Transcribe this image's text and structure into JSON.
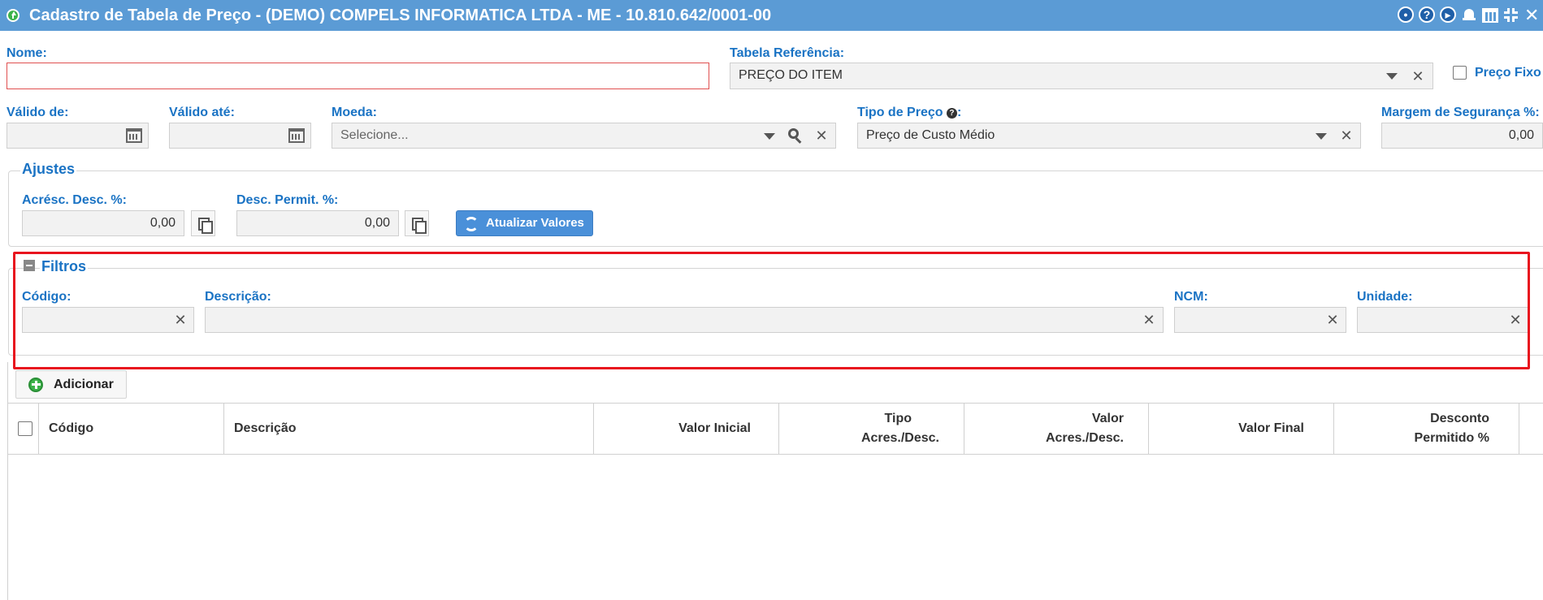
{
  "window": {
    "title": "Cadastro de Tabela de Preço - (DEMO) COMPELS INFORMATICA LTDA - ME - 10.810.642/0001-00",
    "toolbar_icons": [
      "settings-icon",
      "help-icon",
      "play-icon",
      "bell-icon",
      "calendar-icon",
      "fullscreen-icon",
      "close-icon"
    ],
    "help_glyph": "?",
    "close_glyph": "✕"
  },
  "form": {
    "nome": {
      "label": "Nome:",
      "value": ""
    },
    "tabela_referencia": {
      "label": "Tabela Referência:",
      "value": "PREÇO DO ITEM"
    },
    "preco_fixo": {
      "label": "Preço Fixo",
      "checked": false
    },
    "valido_de": {
      "label": "Válido de:",
      "value": ""
    },
    "valido_ate": {
      "label": "Válido até:",
      "value": ""
    },
    "moeda": {
      "label": "Moeda:",
      "placeholder": "Selecione..."
    },
    "tipo_preco": {
      "label": "Tipo de Preço",
      "suffix": ":",
      "value": "Preço de Custo Médio"
    },
    "margem_seguranca": {
      "label": "Margem de Segurança %:",
      "value": "0,00"
    }
  },
  "ajustes": {
    "legend": "Ajustes",
    "acresc_desc": {
      "label": "Acrésc. Desc. %:",
      "value": "0,00"
    },
    "desc_permit": {
      "label": "Desc. Permit. %:",
      "value": "0,00"
    },
    "atualizar_label": "Atualizar Valores"
  },
  "filtros": {
    "legend": "Filtros",
    "codigo": {
      "label": "Código:",
      "value": ""
    },
    "descricao": {
      "label": "Descrição:",
      "value": ""
    },
    "ncm": {
      "label": "NCM:",
      "value": ""
    },
    "unidade": {
      "label": "Unidade:",
      "value": ""
    }
  },
  "grid": {
    "add_label": "Adicionar",
    "columns": [
      {
        "line1": "Código"
      },
      {
        "line1": "Descrição"
      },
      {
        "line1": "Valor Inicial"
      },
      {
        "line1": "Tipo",
        "line2": "Acres./Desc."
      },
      {
        "line1": "Valor",
        "line2": "Acres./Desc."
      },
      {
        "line1": "Valor Final"
      },
      {
        "line1": "Desconto",
        "line2": "Permitido %"
      }
    ],
    "rows": []
  },
  "colors": {
    "titlebar": "#5b9bd5",
    "label": "#1a73c4",
    "highlight": "#e8141e",
    "button": "#4a90d9",
    "add_icon": "#3cb34a"
  }
}
